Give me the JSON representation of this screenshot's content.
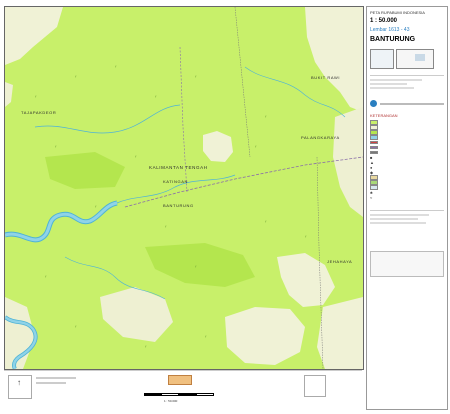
{
  "header": {
    "series_title": "PETA RUPABUMI INDONESIA",
    "scale": "1 : 50.000",
    "sheet_number": "Lembar 1613 - 43",
    "sheet_name": "BANTURUNG"
  },
  "map": {
    "place_names": [
      {
        "id": "bukit-rawi",
        "text": "BUKIT RAWI"
      },
      {
        "id": "palangkaraya",
        "text": "PALANGKARAYA"
      },
      {
        "id": "tajapakdeor",
        "text": "TAJAPAKDEOR"
      },
      {
        "id": "kalimantan-tengah",
        "text": "KALIMANTAN TENGAH"
      },
      {
        "id": "katingan",
        "text": "KATINGAN"
      },
      {
        "id": "banturung",
        "text": "BANTURUNG"
      },
      {
        "id": "jehahaya",
        "text": "JEHAHAYA"
      }
    ],
    "colors": {
      "vegetation": "#c8f06a",
      "vegetation_dark": "#b4e64e",
      "clearing": "#f0f2d6",
      "river": "#8fd3e8",
      "river_edge": "#4fb3d6",
      "boundary": "#8a6fa8",
      "road": "#777777"
    }
  },
  "legend": {
    "heading": "KETERANGAN",
    "entries": [
      "",
      "",
      "",
      "",
      "",
      "",
      "",
      "",
      "",
      "",
      "",
      "",
      "",
      "",
      "",
      "",
      "",
      "",
      "",
      ""
    ]
  },
  "footer": {
    "scale_bar_label": "1 : 50.000"
  }
}
